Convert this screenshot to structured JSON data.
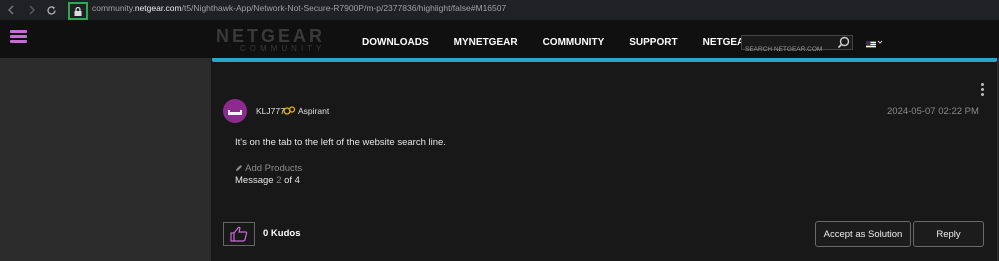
{
  "browser": {
    "url_prefix": "community.",
    "url_domain": "netgear.com",
    "url_path": "/t5/Nighthawk-App/Network-Not-Secure-R7900P/m-p/2377836/highlight/false#M16507",
    "back_icon": "arrow-left-icon",
    "forward_icon": "arrow-right-icon",
    "reload_icon": "reload-icon",
    "lock_icon": "lock-icon",
    "lock_highlight_color": "#2fa84f"
  },
  "header": {
    "logo_main": "NETGEAR",
    "logo_sub": "COMMUNITY",
    "nav": [
      "DOWNLOADS",
      "MYNETGEAR",
      "COMMUNITY",
      "SUPPORT",
      "NETGEAR"
    ],
    "search_placeholder": "SEARCH NETGEAR.COM",
    "menu_color": "#c86bd8"
  },
  "post": {
    "accent_color": "#2aa4c8",
    "username": "KLJ777",
    "rank": "Aspirant",
    "datetime": "2024-05-07 02:22 PM",
    "body": "It's on the tab to the left of the website search line.",
    "add_products": "Add Products",
    "message_prefix": "Message ",
    "message_number": "2",
    "message_suffix": " of 4",
    "kudos": "0 Kudos",
    "accept_label": "Accept as Solution",
    "reply_label": "Reply"
  }
}
